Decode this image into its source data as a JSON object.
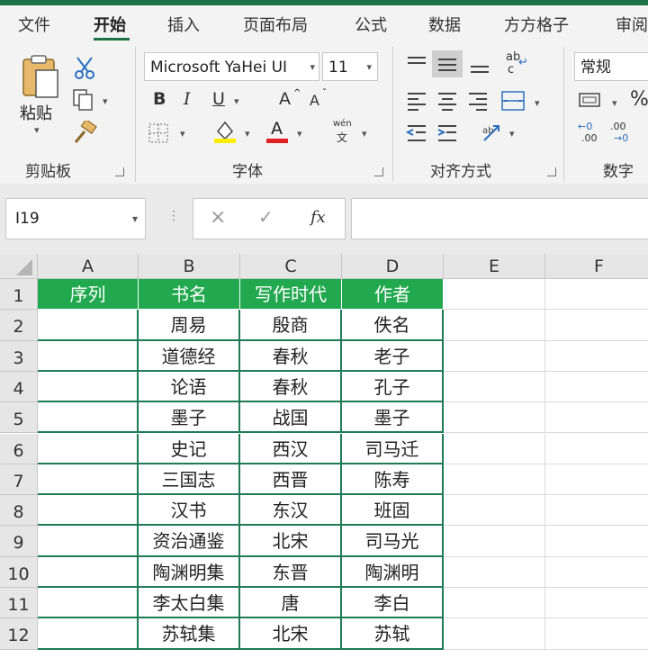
{
  "ribbon": {
    "tabs": [
      "文件",
      "开始",
      "插入",
      "页面布局",
      "公式",
      "数据",
      "方方格子",
      "审阅"
    ],
    "active_tab": "开始",
    "clipboard": {
      "paste_label": "粘贴",
      "group_label": "剪贴板"
    },
    "font": {
      "font_name": "Microsoft YaHei UI",
      "font_size": "11",
      "group_label": "字体",
      "bold_label": "B",
      "italic_label": "I",
      "underline_label": "U",
      "grow_label": "A",
      "shrink_label": "A",
      "font_color_label": "A",
      "phonetic_top": "wén",
      "phonetic_bottom": "文"
    },
    "alignment": {
      "group_label": "对齐方式",
      "wrap_label": "ab",
      "wrap_label2": "c"
    },
    "number": {
      "format": "常规",
      "group_label": "数字",
      "percent": "%",
      "inc_decimal_top": "←0",
      "inc_decimal_bottom": ".00",
      "dec_decimal_top": ".00",
      "dec_decimal_bottom": "→0"
    },
    "colors": {
      "accent": "#1e7145",
      "fill_yellow": "#ffee00",
      "font_red": "#e02020"
    }
  },
  "formula_bar": {
    "name_box": "I19",
    "cancel": "×",
    "enter": "✓",
    "fx": "fx",
    "value": ""
  },
  "sheet": {
    "columns": [
      "A",
      "B",
      "C",
      "D",
      "E",
      "F"
    ],
    "rows": [
      "1",
      "2",
      "3",
      "4",
      "5",
      "6",
      "7",
      "8",
      "9",
      "10",
      "11",
      "12"
    ],
    "header": {
      "a": "序列",
      "b": "书名",
      "c": "写作时代",
      "d": "作者"
    },
    "data": [
      {
        "b": "周易",
        "c": "殷商",
        "d": "佚名"
      },
      {
        "b": "道德经",
        "c": "春秋",
        "d": "老子"
      },
      {
        "b": "论语",
        "c": "春秋",
        "d": "孔子"
      },
      {
        "b": "墨子",
        "c": "战国",
        "d": "墨子"
      },
      {
        "b": "史记",
        "c": "西汉",
        "d": "司马迁"
      },
      {
        "b": "三国志",
        "c": "西晋",
        "d": "陈寿"
      },
      {
        "b": "汉书",
        "c": "东汉",
        "d": "班固"
      },
      {
        "b": "资治通鉴",
        "c": "北宋",
        "d": "司马光"
      },
      {
        "b": "陶渊明集",
        "c": "东晋",
        "d": "陶渊明"
      },
      {
        "b": "李太白集",
        "c": "唐",
        "d": "李白"
      },
      {
        "b": "苏轼集",
        "c": "北宋",
        "d": "苏轼"
      }
    ]
  }
}
